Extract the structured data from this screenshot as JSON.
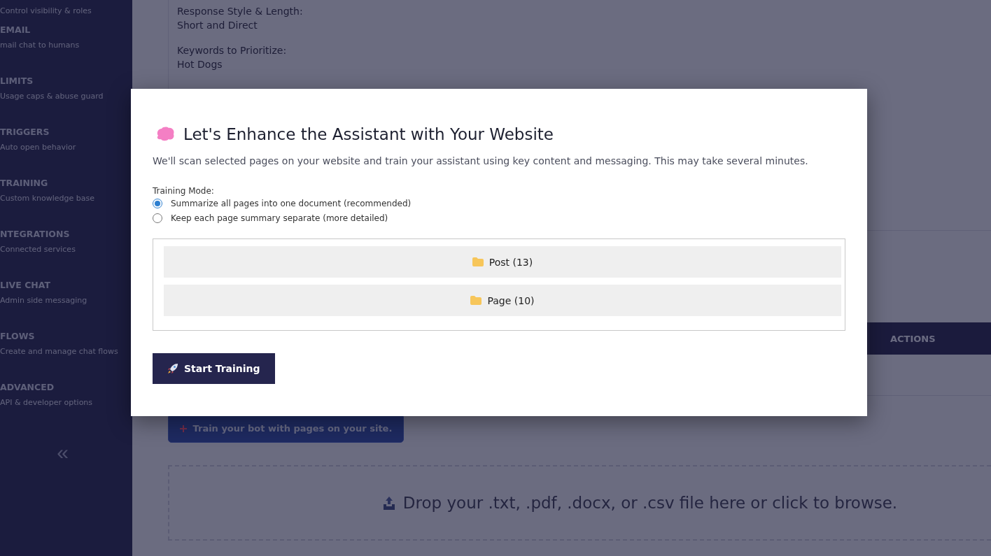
{
  "sidebar": {
    "items": [
      {
        "subtitle": "Control visibility & roles"
      },
      {
        "title": "EMAIL",
        "subtitle": "mail chat to humans"
      },
      {
        "title": "LIMITS",
        "subtitle": "Usage caps & abuse guard"
      },
      {
        "title": "TRIGGERS",
        "subtitle": "Auto open behavior"
      },
      {
        "title": "TRAINING",
        "subtitle": "Custom knowledge base"
      },
      {
        "title": "NTEGRATIONS",
        "subtitle": "Connected services"
      },
      {
        "title": "LIVE CHAT",
        "subtitle": "Admin side messaging"
      },
      {
        "title": "FLOWS",
        "subtitle": "Create and manage chat flows"
      },
      {
        "title": "ADVANCED",
        "subtitle": "API & developer options"
      }
    ],
    "collapse": "«"
  },
  "settings": [
    {
      "label": "Response Style & Length:",
      "value": "Short and Direct"
    },
    {
      "label": "Keywords to Prioritize:",
      "value": "Hot Dogs"
    }
  ],
  "table": {
    "columns": [
      "ACTIONS"
    ]
  },
  "train_button": "Train your bot with pages on your site.",
  "dropzone": "Drop your .txt, .pdf, .docx, or .csv file here or click to browse.",
  "modal": {
    "title": "Let's Enhance the Assistant with Your Website",
    "description": "We'll scan selected pages on your website and train your assistant using key content and messaging. This may take several minutes.",
    "mode_label": "Training Mode:",
    "modes": [
      {
        "label": "Summarize all pages into one document (recommended)",
        "selected": true
      },
      {
        "label": "Keep each page summary separate (more detailed)",
        "selected": false
      }
    ],
    "folders": [
      {
        "label": "Post (13)"
      },
      {
        "label": "Page (10)"
      }
    ],
    "start_button": "Start Training"
  }
}
